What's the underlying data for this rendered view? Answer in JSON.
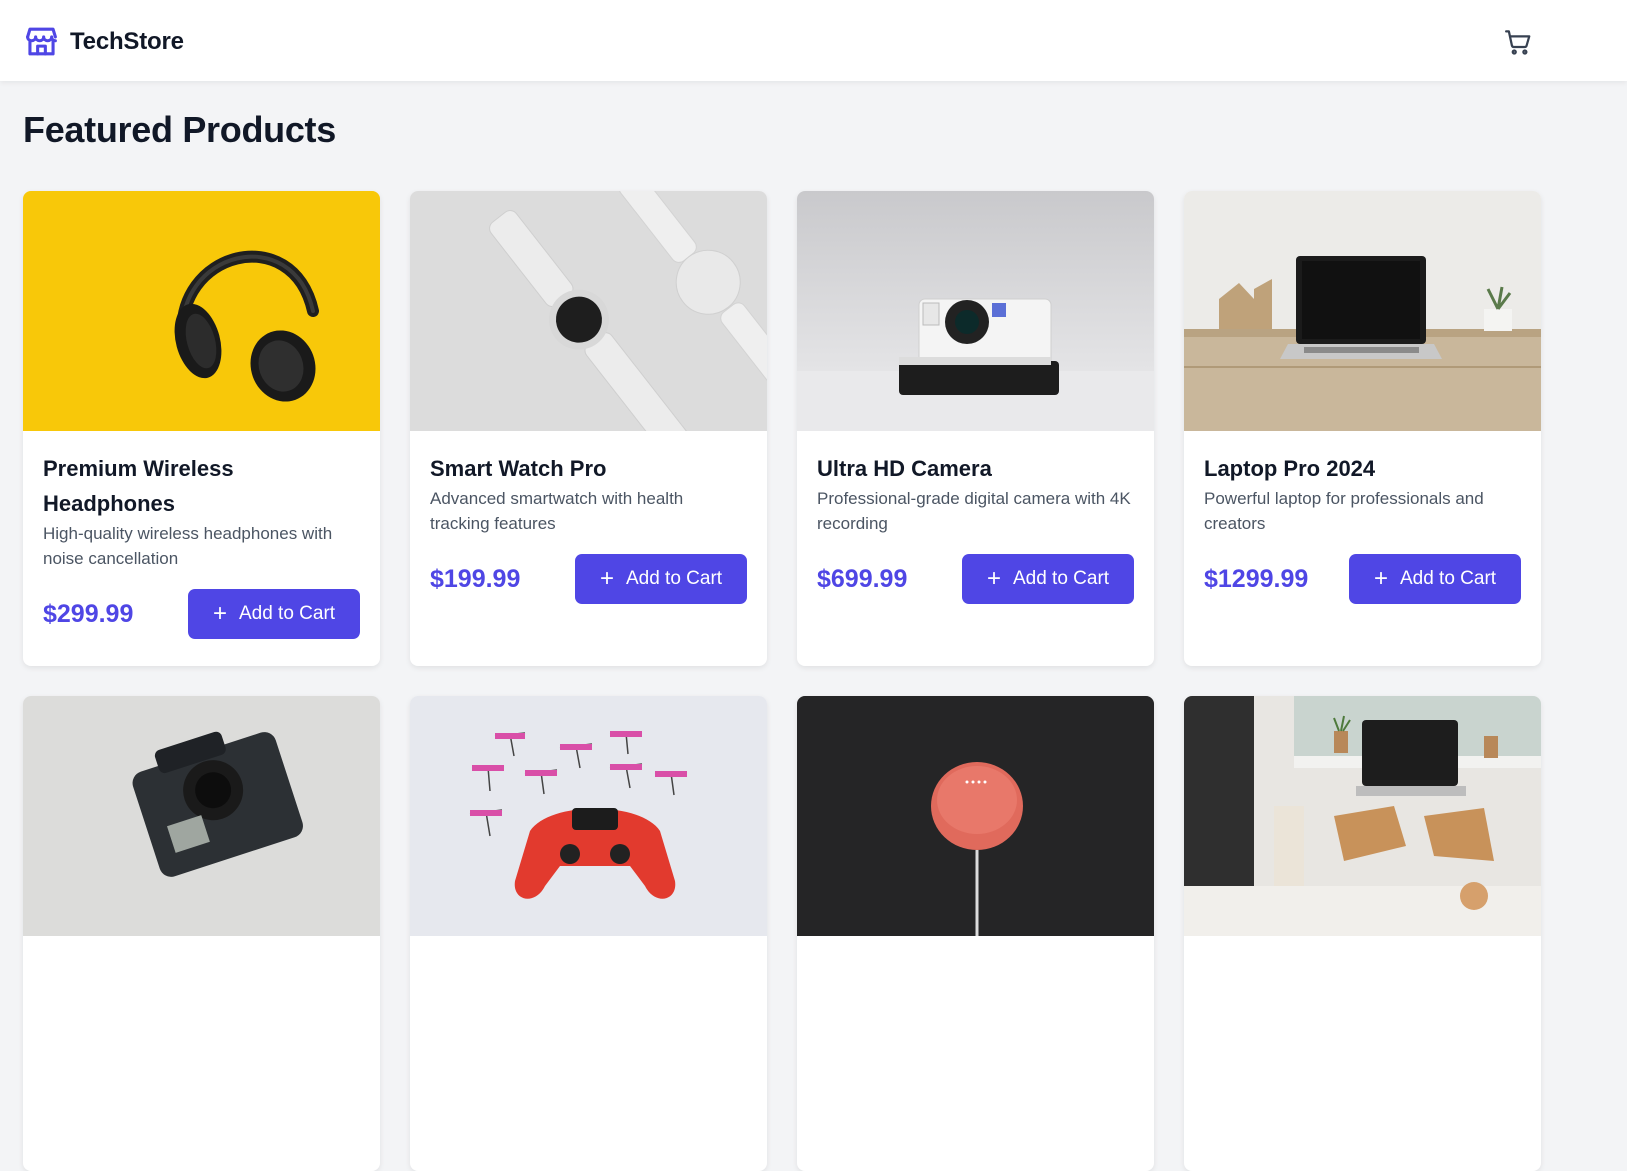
{
  "brand": {
    "name": "TechStore",
    "icon": "store-icon"
  },
  "header": {
    "cart_icon": "cart-icon"
  },
  "page": {
    "title": "Featured Products"
  },
  "accent_color": "#4f46e5",
  "products": [
    {
      "name": "Premium Wireless Headphones",
      "description": "High-quality wireless headphones with noise cancellation",
      "price": "$299.99",
      "button_label": "Add to Cart",
      "image": "headphones-image"
    },
    {
      "name": "Smart Watch Pro",
      "description": "Advanced smartwatch with health tracking features",
      "price": "$199.99",
      "button_label": "Add to Cart",
      "image": "smartwatch-image"
    },
    {
      "name": "Ultra HD Camera",
      "description": "Professional-grade digital camera with 4K recording",
      "price": "$699.99",
      "button_label": "Add to Cart",
      "image": "camera-image"
    },
    {
      "name": "Laptop Pro 2024",
      "description": "Powerful laptop for professionals and creators",
      "price": "$1299.99",
      "button_label": "Add to Cart",
      "image": "laptop-image"
    },
    {
      "image": "action-camera-image"
    },
    {
      "image": "game-controller-image"
    },
    {
      "image": "smart-speaker-image"
    },
    {
      "image": "workspace-laptop-image"
    }
  ]
}
